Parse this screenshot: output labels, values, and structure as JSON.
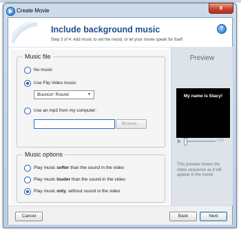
{
  "window": {
    "title": "Create Movie",
    "close_label": "x"
  },
  "header": {
    "title": "Include background music",
    "subtitle": "Step 3 of 4: Add music to set the mood, or let your movie speak for itself",
    "help_label": "?"
  },
  "music_file": {
    "group_title": "Music file",
    "options": [
      {
        "label": "No music",
        "checked": false
      },
      {
        "label": "Use Flip Video music:",
        "checked": true
      },
      {
        "label": "Use an mp3 from my computer:",
        "checked": false
      }
    ],
    "flip_music_selected": "Bouncin' Round",
    "mp3_path": "",
    "browse_label": "Browse..."
  },
  "music_options": {
    "group_title": "Music options",
    "options": [
      {
        "pre": "Play music ",
        "bold": "softer",
        "post": " than the sound in the video",
        "checked": false
      },
      {
        "pre": "Play music ",
        "bold": "louder",
        "post": " than the sound in the video",
        "checked": false
      },
      {
        "pre": "Play music ",
        "bold": "only",
        "post": ", without sound in the video",
        "checked": true
      }
    ]
  },
  "preview": {
    "title": "Preview",
    "video_caption": "My name is Stacy!",
    "time": "0:10",
    "description": "This preview shows the video sequence as it will appear in the movie"
  },
  "footer": {
    "cancel_label": "Cancel",
    "back_label": "Back",
    "next_label": "Next"
  }
}
